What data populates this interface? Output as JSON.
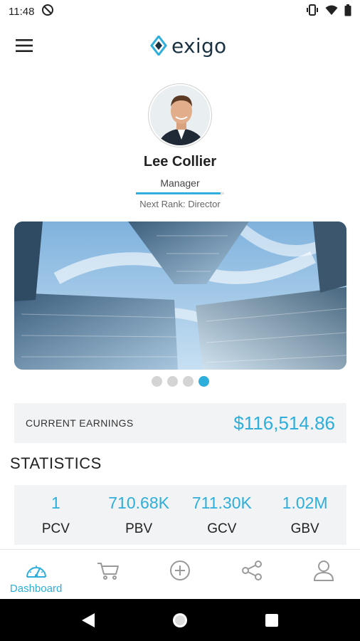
{
  "status_bar": {
    "time": "11:48"
  },
  "app": {
    "logo_text": "exigo"
  },
  "profile": {
    "name": "Lee Collier",
    "rank": "Manager",
    "rank_progress": 0.96,
    "next_rank": "Next Rank: Director"
  },
  "carousel": {
    "slide_count": 4,
    "active_index": 3
  },
  "earnings": {
    "label": "CURRENT EARNINGS",
    "value": "$116,514.86"
  },
  "statistics": {
    "title": "STATISTICS",
    "items": [
      {
        "value": "1",
        "label": "PCV"
      },
      {
        "value": "710.68K",
        "label": "PBV"
      },
      {
        "value": "711.30K",
        "label": "GCV"
      },
      {
        "value": "1.02M",
        "label": "GBV"
      }
    ]
  },
  "bottom_nav": {
    "items": [
      {
        "icon": "dashboard-gauge-icon",
        "label": "Dashboard",
        "active": true
      },
      {
        "icon": "cart-icon",
        "label": "",
        "active": false
      },
      {
        "icon": "plus-circle-icon",
        "label": "",
        "active": false
      },
      {
        "icon": "share-icon",
        "label": "",
        "active": false
      },
      {
        "icon": "user-icon",
        "label": "",
        "active": false
      }
    ]
  },
  "colors": {
    "accent": "#2eaedb",
    "panel": "#f1f3f4",
    "logo_dark": "#1a3242"
  }
}
